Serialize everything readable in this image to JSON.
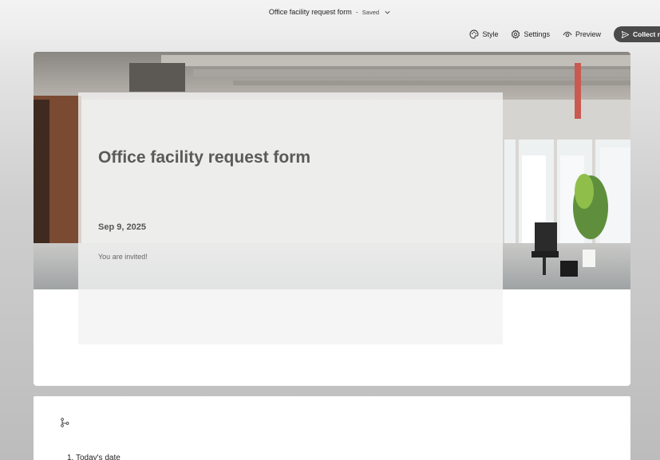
{
  "titlebar": {
    "form_name": "Office facility request form",
    "separator": "-",
    "status": "Saved"
  },
  "toolbar": {
    "style_label": "Style",
    "settings_label": "Settings",
    "preview_label": "Preview",
    "collect_label": "Collect r"
  },
  "header": {
    "title": "Office facility request form",
    "date": "Sep 9, 2025",
    "subtitle": "You are invited!"
  },
  "question": {
    "number": "1.",
    "label": "Today's date"
  },
  "colors": {
    "collect_bg": "#4a4a4a",
    "panel_bg": "#f2f2f2"
  }
}
